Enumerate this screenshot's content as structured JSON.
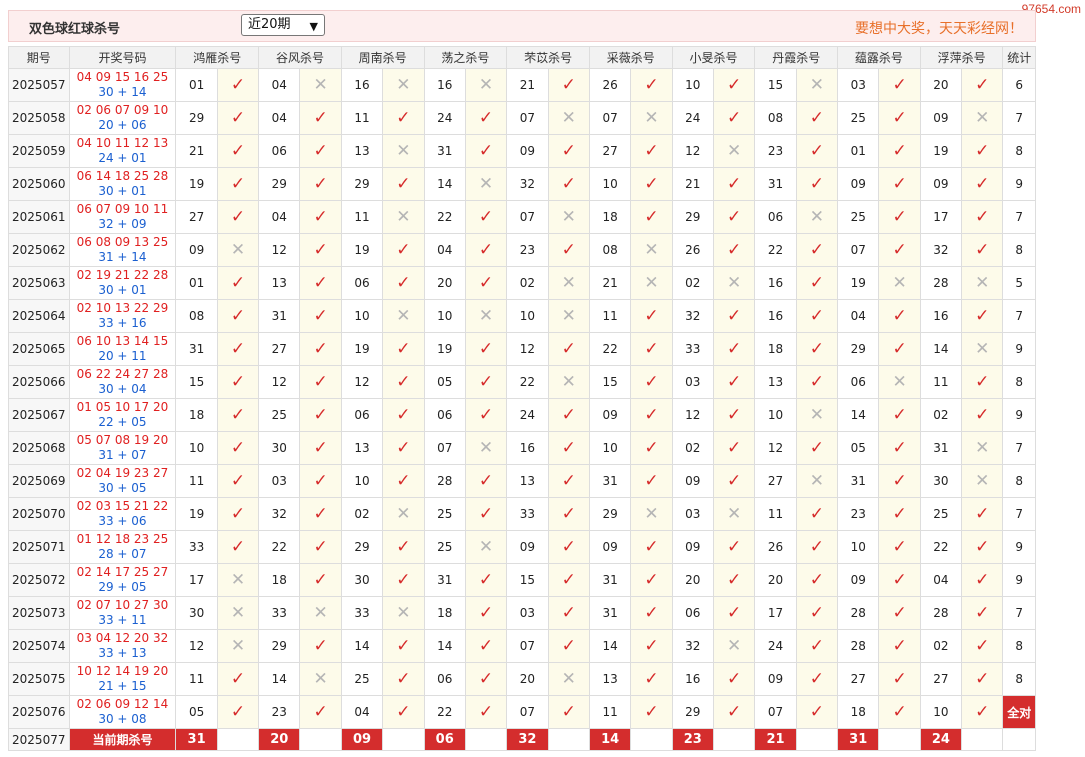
{
  "watermark": "97654.com",
  "header": {
    "title": "双色球红球杀号",
    "period_select": "近20期",
    "slogan": "要想中大奖，天天彩经网！"
  },
  "columns": {
    "period": "期号",
    "draw": "开奖号码",
    "experts": [
      "鸿雁杀号",
      "谷风杀号",
      "周南杀号",
      "荡之杀号",
      "芣苡杀号",
      "采薇杀号",
      "小旻杀号",
      "丹霞杀号",
      "蕴露杀号",
      "浮萍杀号"
    ],
    "stat": "统计"
  },
  "rows": [
    {
      "p": "2025057",
      "d": "04 09 15 16 25",
      "b": "30 + 14",
      "k": [
        [
          "01",
          1
        ],
        [
          "04",
          0
        ],
        [
          "16",
          0
        ],
        [
          "16",
          0
        ],
        [
          "21",
          1
        ],
        [
          "26",
          1
        ],
        [
          "10",
          1
        ],
        [
          "15",
          0
        ],
        [
          "03",
          1
        ],
        [
          "20",
          1
        ]
      ],
      "s": "6"
    },
    {
      "p": "2025058",
      "d": "02 06 07 09 10",
      "b": "20 + 06",
      "k": [
        [
          "29",
          1
        ],
        [
          "04",
          1
        ],
        [
          "11",
          1
        ],
        [
          "24",
          1
        ],
        [
          "07",
          0
        ],
        [
          "07",
          0
        ],
        [
          "24",
          1
        ],
        [
          "08",
          1
        ],
        [
          "25",
          1
        ],
        [
          "09",
          0
        ]
      ],
      "s": "7"
    },
    {
      "p": "2025059",
      "d": "04 10 11 12 13",
      "b": "24 + 01",
      "k": [
        [
          "21",
          1
        ],
        [
          "06",
          1
        ],
        [
          "13",
          0
        ],
        [
          "31",
          1
        ],
        [
          "09",
          1
        ],
        [
          "27",
          1
        ],
        [
          "12",
          0
        ],
        [
          "23",
          1
        ],
        [
          "01",
          1
        ],
        [
          "19",
          1
        ]
      ],
      "s": "8"
    },
    {
      "p": "2025060",
      "d": "06 14 18 25 28",
      "b": "30 + 01",
      "k": [
        [
          "19",
          1
        ],
        [
          "29",
          1
        ],
        [
          "29",
          1
        ],
        [
          "14",
          0
        ],
        [
          "32",
          1
        ],
        [
          "10",
          1
        ],
        [
          "21",
          1
        ],
        [
          "31",
          1
        ],
        [
          "09",
          1
        ],
        [
          "09",
          1
        ]
      ],
      "s": "9"
    },
    {
      "p": "2025061",
      "d": "06 07 09 10 11",
      "b": "32 + 09",
      "k": [
        [
          "27",
          1
        ],
        [
          "04",
          1
        ],
        [
          "11",
          0
        ],
        [
          "22",
          1
        ],
        [
          "07",
          0
        ],
        [
          "18",
          1
        ],
        [
          "29",
          1
        ],
        [
          "06",
          0
        ],
        [
          "25",
          1
        ],
        [
          "17",
          1
        ]
      ],
      "s": "7"
    },
    {
      "p": "2025062",
      "d": "06 08 09 13 25",
      "b": "31 + 14",
      "k": [
        [
          "09",
          0
        ],
        [
          "12",
          1
        ],
        [
          "19",
          1
        ],
        [
          "04",
          1
        ],
        [
          "23",
          1
        ],
        [
          "08",
          0
        ],
        [
          "26",
          1
        ],
        [
          "22",
          1
        ],
        [
          "07",
          1
        ],
        [
          "32",
          1
        ]
      ],
      "s": "8"
    },
    {
      "p": "2025063",
      "d": "02 19 21 22 28",
      "b": "30 + 01",
      "k": [
        [
          "01",
          1
        ],
        [
          "13",
          1
        ],
        [
          "06",
          1
        ],
        [
          "20",
          1
        ],
        [
          "02",
          0
        ],
        [
          "21",
          0
        ],
        [
          "02",
          0
        ],
        [
          "16",
          1
        ],
        [
          "19",
          0
        ],
        [
          "28",
          0
        ]
      ],
      "s": "5"
    },
    {
      "p": "2025064",
      "d": "02 10 13 22 29",
      "b": "33 + 16",
      "k": [
        [
          "08",
          1
        ],
        [
          "31",
          1
        ],
        [
          "10",
          0
        ],
        [
          "10",
          0
        ],
        [
          "10",
          0
        ],
        [
          "11",
          1
        ],
        [
          "32",
          1
        ],
        [
          "16",
          1
        ],
        [
          "04",
          1
        ],
        [
          "16",
          1
        ]
      ],
      "s": "7"
    },
    {
      "p": "2025065",
      "d": "06 10 13 14 15",
      "b": "20 + 11",
      "k": [
        [
          "31",
          1
        ],
        [
          "27",
          1
        ],
        [
          "19",
          1
        ],
        [
          "19",
          1
        ],
        [
          "12",
          1
        ],
        [
          "22",
          1
        ],
        [
          "33",
          1
        ],
        [
          "18",
          1
        ],
        [
          "29",
          1
        ],
        [
          "14",
          0
        ]
      ],
      "s": "9"
    },
    {
      "p": "2025066",
      "d": "06 22 24 27 28",
      "b": "30 + 04",
      "k": [
        [
          "15",
          1
        ],
        [
          "12",
          1
        ],
        [
          "12",
          1
        ],
        [
          "05",
          1
        ],
        [
          "22",
          0
        ],
        [
          "15",
          1
        ],
        [
          "03",
          1
        ],
        [
          "13",
          1
        ],
        [
          "06",
          0
        ],
        [
          "11",
          1
        ]
      ],
      "s": "8"
    },
    {
      "p": "2025067",
      "d": "01 05 10 17 20",
      "b": "22 + 05",
      "k": [
        [
          "18",
          1
        ],
        [
          "25",
          1
        ],
        [
          "06",
          1
        ],
        [
          "06",
          1
        ],
        [
          "24",
          1
        ],
        [
          "09",
          1
        ],
        [
          "12",
          1
        ],
        [
          "10",
          0
        ],
        [
          "14",
          1
        ],
        [
          "02",
          1
        ]
      ],
      "s": "9"
    },
    {
      "p": "2025068",
      "d": "05 07 08 19 20",
      "b": "31 + 07",
      "k": [
        [
          "10",
          1
        ],
        [
          "30",
          1
        ],
        [
          "13",
          1
        ],
        [
          "07",
          0
        ],
        [
          "16",
          1
        ],
        [
          "10",
          1
        ],
        [
          "02",
          1
        ],
        [
          "12",
          1
        ],
        [
          "05",
          1
        ],
        [
          "31",
          0
        ]
      ],
      "s": "7"
    },
    {
      "p": "2025069",
      "d": "02 04 19 23 27",
      "b": "30 + 05",
      "k": [
        [
          "11",
          1
        ],
        [
          "03",
          1
        ],
        [
          "10",
          1
        ],
        [
          "28",
          1
        ],
        [
          "13",
          1
        ],
        [
          "31",
          1
        ],
        [
          "09",
          1
        ],
        [
          "27",
          0
        ],
        [
          "31",
          1
        ],
        [
          "30",
          0
        ]
      ],
      "s": "8"
    },
    {
      "p": "2025070",
      "d": "02 03 15 21 22",
      "b": "33 + 06",
      "k": [
        [
          "19",
          1
        ],
        [
          "32",
          1
        ],
        [
          "02",
          0
        ],
        [
          "25",
          1
        ],
        [
          "33",
          1
        ],
        [
          "29",
          0
        ],
        [
          "03",
          0
        ],
        [
          "11",
          1
        ],
        [
          "23",
          1
        ],
        [
          "25",
          1
        ]
      ],
      "s": "7"
    },
    {
      "p": "2025071",
      "d": "01 12 18 23 25",
      "b": "28 + 07",
      "k": [
        [
          "33",
          1
        ],
        [
          "22",
          1
        ],
        [
          "29",
          1
        ],
        [
          "25",
          0
        ],
        [
          "09",
          1
        ],
        [
          "09",
          1
        ],
        [
          "09",
          1
        ],
        [
          "26",
          1
        ],
        [
          "10",
          1
        ],
        [
          "22",
          1
        ]
      ],
      "s": "9"
    },
    {
      "p": "2025072",
      "d": "02 14 17 25 27",
      "b": "29 + 05",
      "k": [
        [
          "17",
          0
        ],
        [
          "18",
          1
        ],
        [
          "30",
          1
        ],
        [
          "31",
          1
        ],
        [
          "15",
          1
        ],
        [
          "31",
          1
        ],
        [
          "20",
          1
        ],
        [
          "20",
          1
        ],
        [
          "09",
          1
        ],
        [
          "04",
          1
        ]
      ],
      "s": "9"
    },
    {
      "p": "2025073",
      "d": "02 07 10 27 30",
      "b": "33 + 11",
      "k": [
        [
          "30",
          0
        ],
        [
          "33",
          0
        ],
        [
          "33",
          0
        ],
        [
          "18",
          1
        ],
        [
          "03",
          1
        ],
        [
          "31",
          1
        ],
        [
          "06",
          1
        ],
        [
          "17",
          1
        ],
        [
          "28",
          1
        ],
        [
          "28",
          1
        ]
      ],
      "s": "7"
    },
    {
      "p": "2025074",
      "d": "03 04 12 20 32",
      "b": "33 + 13",
      "k": [
        [
          "12",
          0
        ],
        [
          "29",
          1
        ],
        [
          "14",
          1
        ],
        [
          "14",
          1
        ],
        [
          "07",
          1
        ],
        [
          "14",
          1
        ],
        [
          "32",
          0
        ],
        [
          "24",
          1
        ],
        [
          "28",
          1
        ],
        [
          "02",
          1
        ]
      ],
      "s": "8"
    },
    {
      "p": "2025075",
      "d": "10 12 14 19 20",
      "b": "21 + 15",
      "k": [
        [
          "11",
          1
        ],
        [
          "14",
          0
        ],
        [
          "25",
          1
        ],
        [
          "06",
          1
        ],
        [
          "20",
          0
        ],
        [
          "13",
          1
        ],
        [
          "16",
          1
        ],
        [
          "09",
          1
        ],
        [
          "27",
          1
        ],
        [
          "27",
          1
        ]
      ],
      "s": "8"
    },
    {
      "p": "2025076",
      "d": "02 06 09 12 14",
      "b": "30 + 08",
      "k": [
        [
          "05",
          1
        ],
        [
          "23",
          1
        ],
        [
          "04",
          1
        ],
        [
          "22",
          1
        ],
        [
          "07",
          1
        ],
        [
          "11",
          1
        ],
        [
          "29",
          1
        ],
        [
          "07",
          1
        ],
        [
          "18",
          1
        ],
        [
          "10",
          1
        ]
      ],
      "s": "全对"
    }
  ],
  "current": {
    "p": "2025077",
    "label": "当前期杀号",
    "picks": [
      "31",
      "20",
      "09",
      "06",
      "32",
      "14",
      "23",
      "21",
      "31",
      "24"
    ]
  },
  "marks": {
    "ok": "✓",
    "no": "✕"
  },
  "colors": {
    "accent": "#d42d2d",
    "header_bg": "#fdeeee",
    "slogan": "#e8702a"
  }
}
